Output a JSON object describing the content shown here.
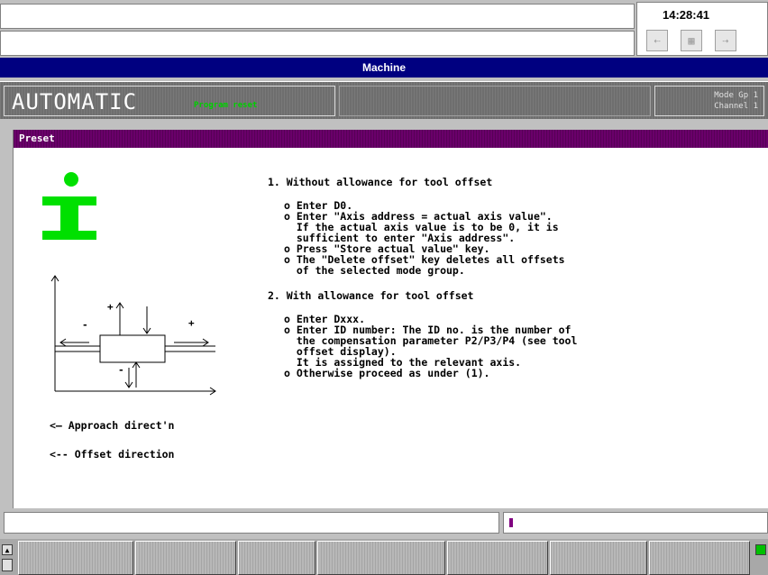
{
  "time": "14:28:41",
  "window_title": "Machine",
  "mode": {
    "name": "AUTOMATIC",
    "status": "Program reset",
    "group_line1": "Mode Gp 1",
    "group_line2": "Channel 1"
  },
  "panel_title": "Preset",
  "section1": {
    "heading": "1. Without allowance for tool offset",
    "lines": [
      "o Enter D0.",
      "o Enter \"Axis address = actual axis value\".",
      "  If the actual axis value is to be 0, it is",
      "  sufficient to enter \"Axis address\".",
      "o Press \"Store actual value\" key.",
      "o The \"Delete offset\" key deletes all offsets",
      "  of the selected mode group."
    ]
  },
  "section2": {
    "heading": "2. With allowance for tool offset",
    "lines": [
      "o Enter Dxxx.",
      "o Enter ID number: The ID no. is the number of",
      "  the compensation parameter P2/P3/P4 (see tool",
      "  offset display).",
      "  It is assigned to the relevant axis.",
      "o Otherwise proceed as under (1)."
    ]
  },
  "legend": {
    "approach": "<— Approach direct'n",
    "offset": "<-- Offset direction"
  },
  "diagram": {
    "plus_left": "+",
    "minus_left": "-",
    "plus_right": "+",
    "minus_bottom": "-"
  },
  "colors": {
    "title_bar": "#000080",
    "panel_header": "#6a006a",
    "info_icon": "#00e000",
    "status_green": "#00d000"
  },
  "icons": [
    "info-icon",
    "toolbar-icon-1",
    "toolbar-icon-2",
    "toolbar-icon-3",
    "scroll-up-icon",
    "recall-icon"
  ]
}
